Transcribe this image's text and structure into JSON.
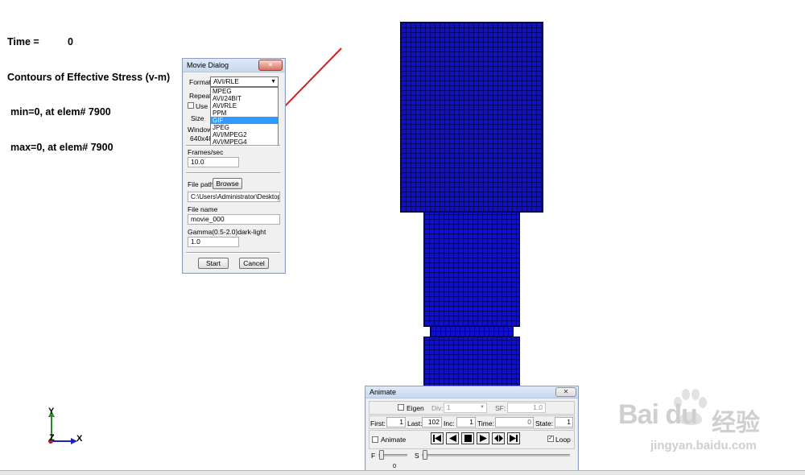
{
  "header": {
    "time_label": "Time =",
    "time_value": "0",
    "contours": "Contours of Effective Stress (v-m)",
    "min_line": "min=0, at elem# 7900",
    "max_line": "max=0, at elem# 7900"
  },
  "movie_dialog": {
    "title": "Movie Dialog",
    "close_glyph": "✕",
    "format_label": "Format",
    "format_value": "AVI/RLE",
    "format_options": [
      "MPEG",
      "AVI/24BIT",
      "AVI/RLE",
      "PPM",
      "GIF",
      "JPEG",
      "AVI/MPEG2",
      "AVI/MPEG4"
    ],
    "format_selected": "GIF",
    "repeat_label": "Repeat",
    "use_label": "Use P",
    "size_label": "Size",
    "window_label": "Window",
    "window_value": "640x48",
    "frames_label": "Frames/sec",
    "frames_value": "10.0",
    "filepath_label": "File path",
    "browse_label": "Browse",
    "filepath_value": "C:\\Users\\Administrator\\Desktop",
    "filename_label": "File name",
    "filename_value": "movie_000",
    "gamma_label": "Gamma(0.5-2.0)dark-light",
    "gamma_value": "1.0",
    "start_label": "Start",
    "cancel_label": "Cancel"
  },
  "animate_dialog": {
    "title": "Animate",
    "close_glyph": "✕",
    "eigen_label": "Eigen",
    "div_label": "Div:",
    "div_value": "1",
    "sf_label": "SF:",
    "sf_value": "1.0",
    "first_label": "First:",
    "first_value": "1",
    "last_label": "Last:",
    "last_value": "102",
    "inc_label": "Inc:",
    "inc_value": "1",
    "time_label": "Time:",
    "time_value": "0",
    "state_label": "State:",
    "state_value": "1",
    "animate_label": "Animate",
    "loop_label": "Loop",
    "loop_checked": true,
    "f_label": "F",
    "f_value": "0",
    "s_label": "S"
  },
  "axes": {
    "y": "Y",
    "z": "Z",
    "x": "X"
  },
  "watermark": {
    "brand": "Bai du",
    "cn": "经验",
    "url": "jingyan.baidu.com"
  },
  "colors": {
    "mesh": "#1010c8",
    "arrow": "#d42020",
    "selection": "#3399ff"
  }
}
